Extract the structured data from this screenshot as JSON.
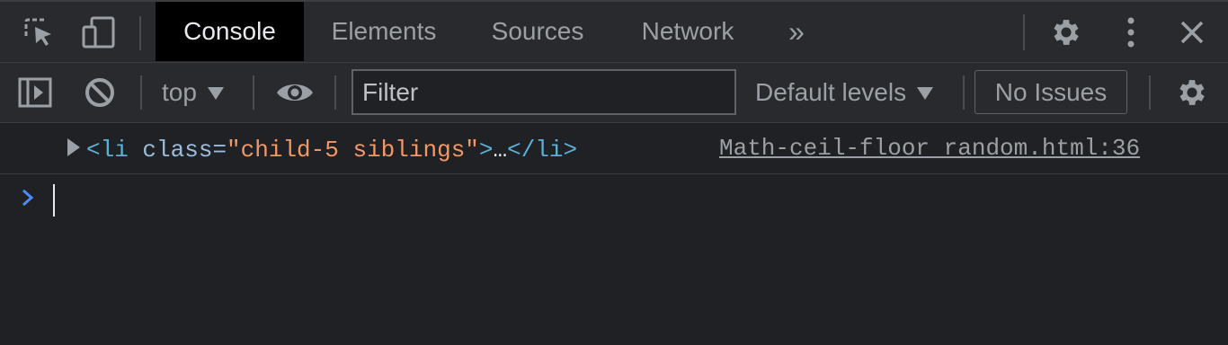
{
  "tabbar": {
    "tabs": [
      {
        "label": "Console",
        "active": true
      },
      {
        "label": "Elements",
        "active": false
      },
      {
        "label": "Sources",
        "active": false
      },
      {
        "label": "Network",
        "active": false
      }
    ],
    "more_tabs_glyph": "»"
  },
  "toolbar": {
    "context_label": "top",
    "filter_placeholder": "Filter",
    "filter_value": "",
    "levels_label": "Default levels",
    "issues_label": "No Issues"
  },
  "console": {
    "message": {
      "tag_open": "<li",
      "attr_name": "class",
      "attr_eq": "=",
      "attr_value": "\"child-5 siblings\"",
      "tag_close_open": ">",
      "ellipsis": "…",
      "tag_end": "</li>",
      "source": "Math-ceil-floor random.html:36"
    },
    "prompt_glyph": "›"
  },
  "colors": {
    "background": "#202124",
    "toolbar": "#292a2d",
    "active_tab": "#000000",
    "tag": "#5db0d7",
    "attr_value": "#f29766",
    "prompt": "#4c8bf5"
  }
}
